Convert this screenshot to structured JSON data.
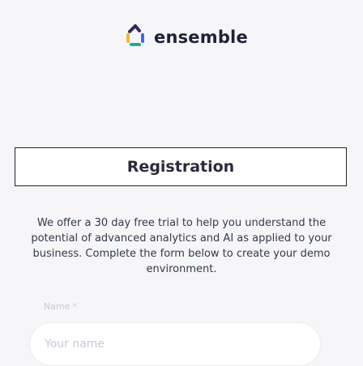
{
  "brand": {
    "name": "ensemble",
    "logo_icon": "ensemble-logo-icon",
    "colors": [
      "#f3b63a",
      "#2aa88f",
      "#3d6fd8",
      "#2c2c5c"
    ]
  },
  "banner": {
    "title": "Registration"
  },
  "intro": {
    "text": "We offer a 30 day free trial to help you understand the potential of advanced analytics and AI as applied to your business. Complete the form below to create your demo environment."
  },
  "form": {
    "name_label": "Name",
    "required_marker": "*",
    "name_placeholder": "Your name",
    "name_value": ""
  }
}
